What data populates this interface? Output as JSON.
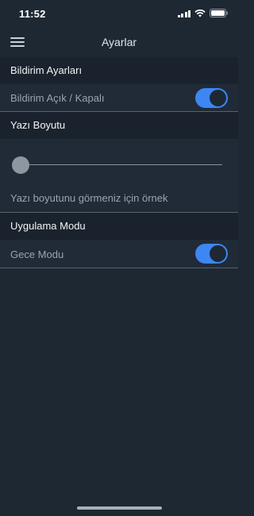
{
  "status_bar": {
    "time": "11:52"
  },
  "nav": {
    "title": "Ayarlar",
    "menu_icon": "hamburger-menu-icon"
  },
  "sections": {
    "notifications": {
      "header": "Bildirim Ayarları",
      "toggle_label": "Bildirim Açık / Kapalı",
      "toggle_on": true
    },
    "font_size": {
      "header": "Yazı Boyutu",
      "slider_level": 0,
      "sample_text": "Yazı boyutunu görmeniz için örnek"
    },
    "app_mode": {
      "header": "Uygulama Modu",
      "toggle_label": "Gece Modu",
      "toggle_on": true
    }
  },
  "colors": {
    "background": "#1e2833",
    "section_header_bg": "#1a232d",
    "row_bg": "#202b37",
    "accent": "#3d86f4",
    "muted_text": "#9aa4ae"
  }
}
